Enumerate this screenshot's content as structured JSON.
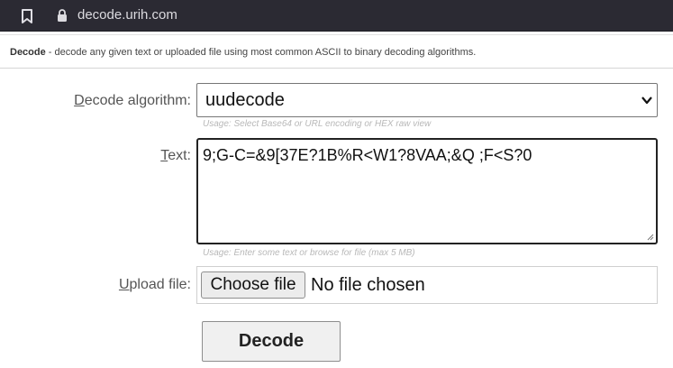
{
  "browser": {
    "url": "decode.urih.com",
    "icons": {
      "bookmark": "bookmark-icon",
      "lock": "lock-icon"
    }
  },
  "intro": {
    "title": "Decode",
    "description": " - decode any given text or uploaded file using most common ASCII to binary decoding algorithms."
  },
  "form": {
    "algorithm": {
      "label_access": "D",
      "label_rest": "ecode algorithm:",
      "value": "uudecode",
      "hint": "Usage: Select Base64 or URL encoding or HEX raw view"
    },
    "text": {
      "label_access": "T",
      "label_rest": "ext:",
      "value": "9;G-C=&9[37E?1B%R<W1?8VAA;&Q ;F<S?0",
      "hint": "Usage: Enter some text or browse for file (max 5 MB)"
    },
    "upload": {
      "label_access": "U",
      "label_rest": "pload file:",
      "button_label": "Choose file",
      "status": "No file chosen"
    },
    "submit_label": "Decode"
  },
  "colors": {
    "browser_bar": "#2b2a33",
    "textarea_border": "#222222"
  }
}
